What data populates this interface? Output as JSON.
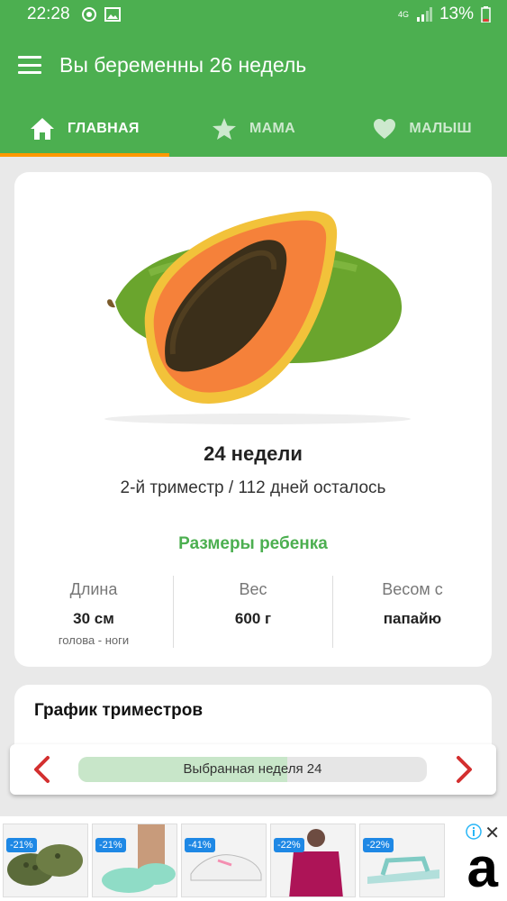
{
  "status_bar": {
    "time": "22:28",
    "network": "4G",
    "battery": "13%"
  },
  "app_bar": {
    "title": "Вы беременны 26 недель"
  },
  "tabs": [
    {
      "label": "ГЛАВНАЯ",
      "icon": "home-icon",
      "active": true
    },
    {
      "label": "МАМА",
      "icon": "star-icon",
      "active": false
    },
    {
      "label": "МАЛЫШ",
      "icon": "heart-icon",
      "active": false
    }
  ],
  "baby": {
    "image": "papaya-fruit",
    "week": "24 недели",
    "trimester": "2-й триместр / 112 дней осталось",
    "sizes_title": "Размеры ребенка",
    "sizes": [
      {
        "label": "Длина",
        "value": "30 см",
        "sub": "голова - ноги"
      },
      {
        "label": "Вес",
        "value": "600 г",
        "sub": ""
      },
      {
        "label": "Весом с",
        "value": "папайю",
        "sub": ""
      }
    ]
  },
  "trimester_chart": {
    "title": "График триместров"
  },
  "week_selector": {
    "label": "Выбранная неделя 24",
    "progress": 0.6
  },
  "ads": {
    "items": [
      {
        "badge": "-21%",
        "product": "clogs"
      },
      {
        "badge": "-21%",
        "product": "clogs"
      },
      {
        "badge": "-41%",
        "product": "sneakers"
      },
      {
        "badge": "-22%",
        "product": "blouse"
      },
      {
        "badge": "-22%",
        "product": "sandals"
      }
    ],
    "logo": "a"
  },
  "colors": {
    "primary": "#4caf50",
    "accent": "#ff9800",
    "arrow": "#d32f2f"
  }
}
